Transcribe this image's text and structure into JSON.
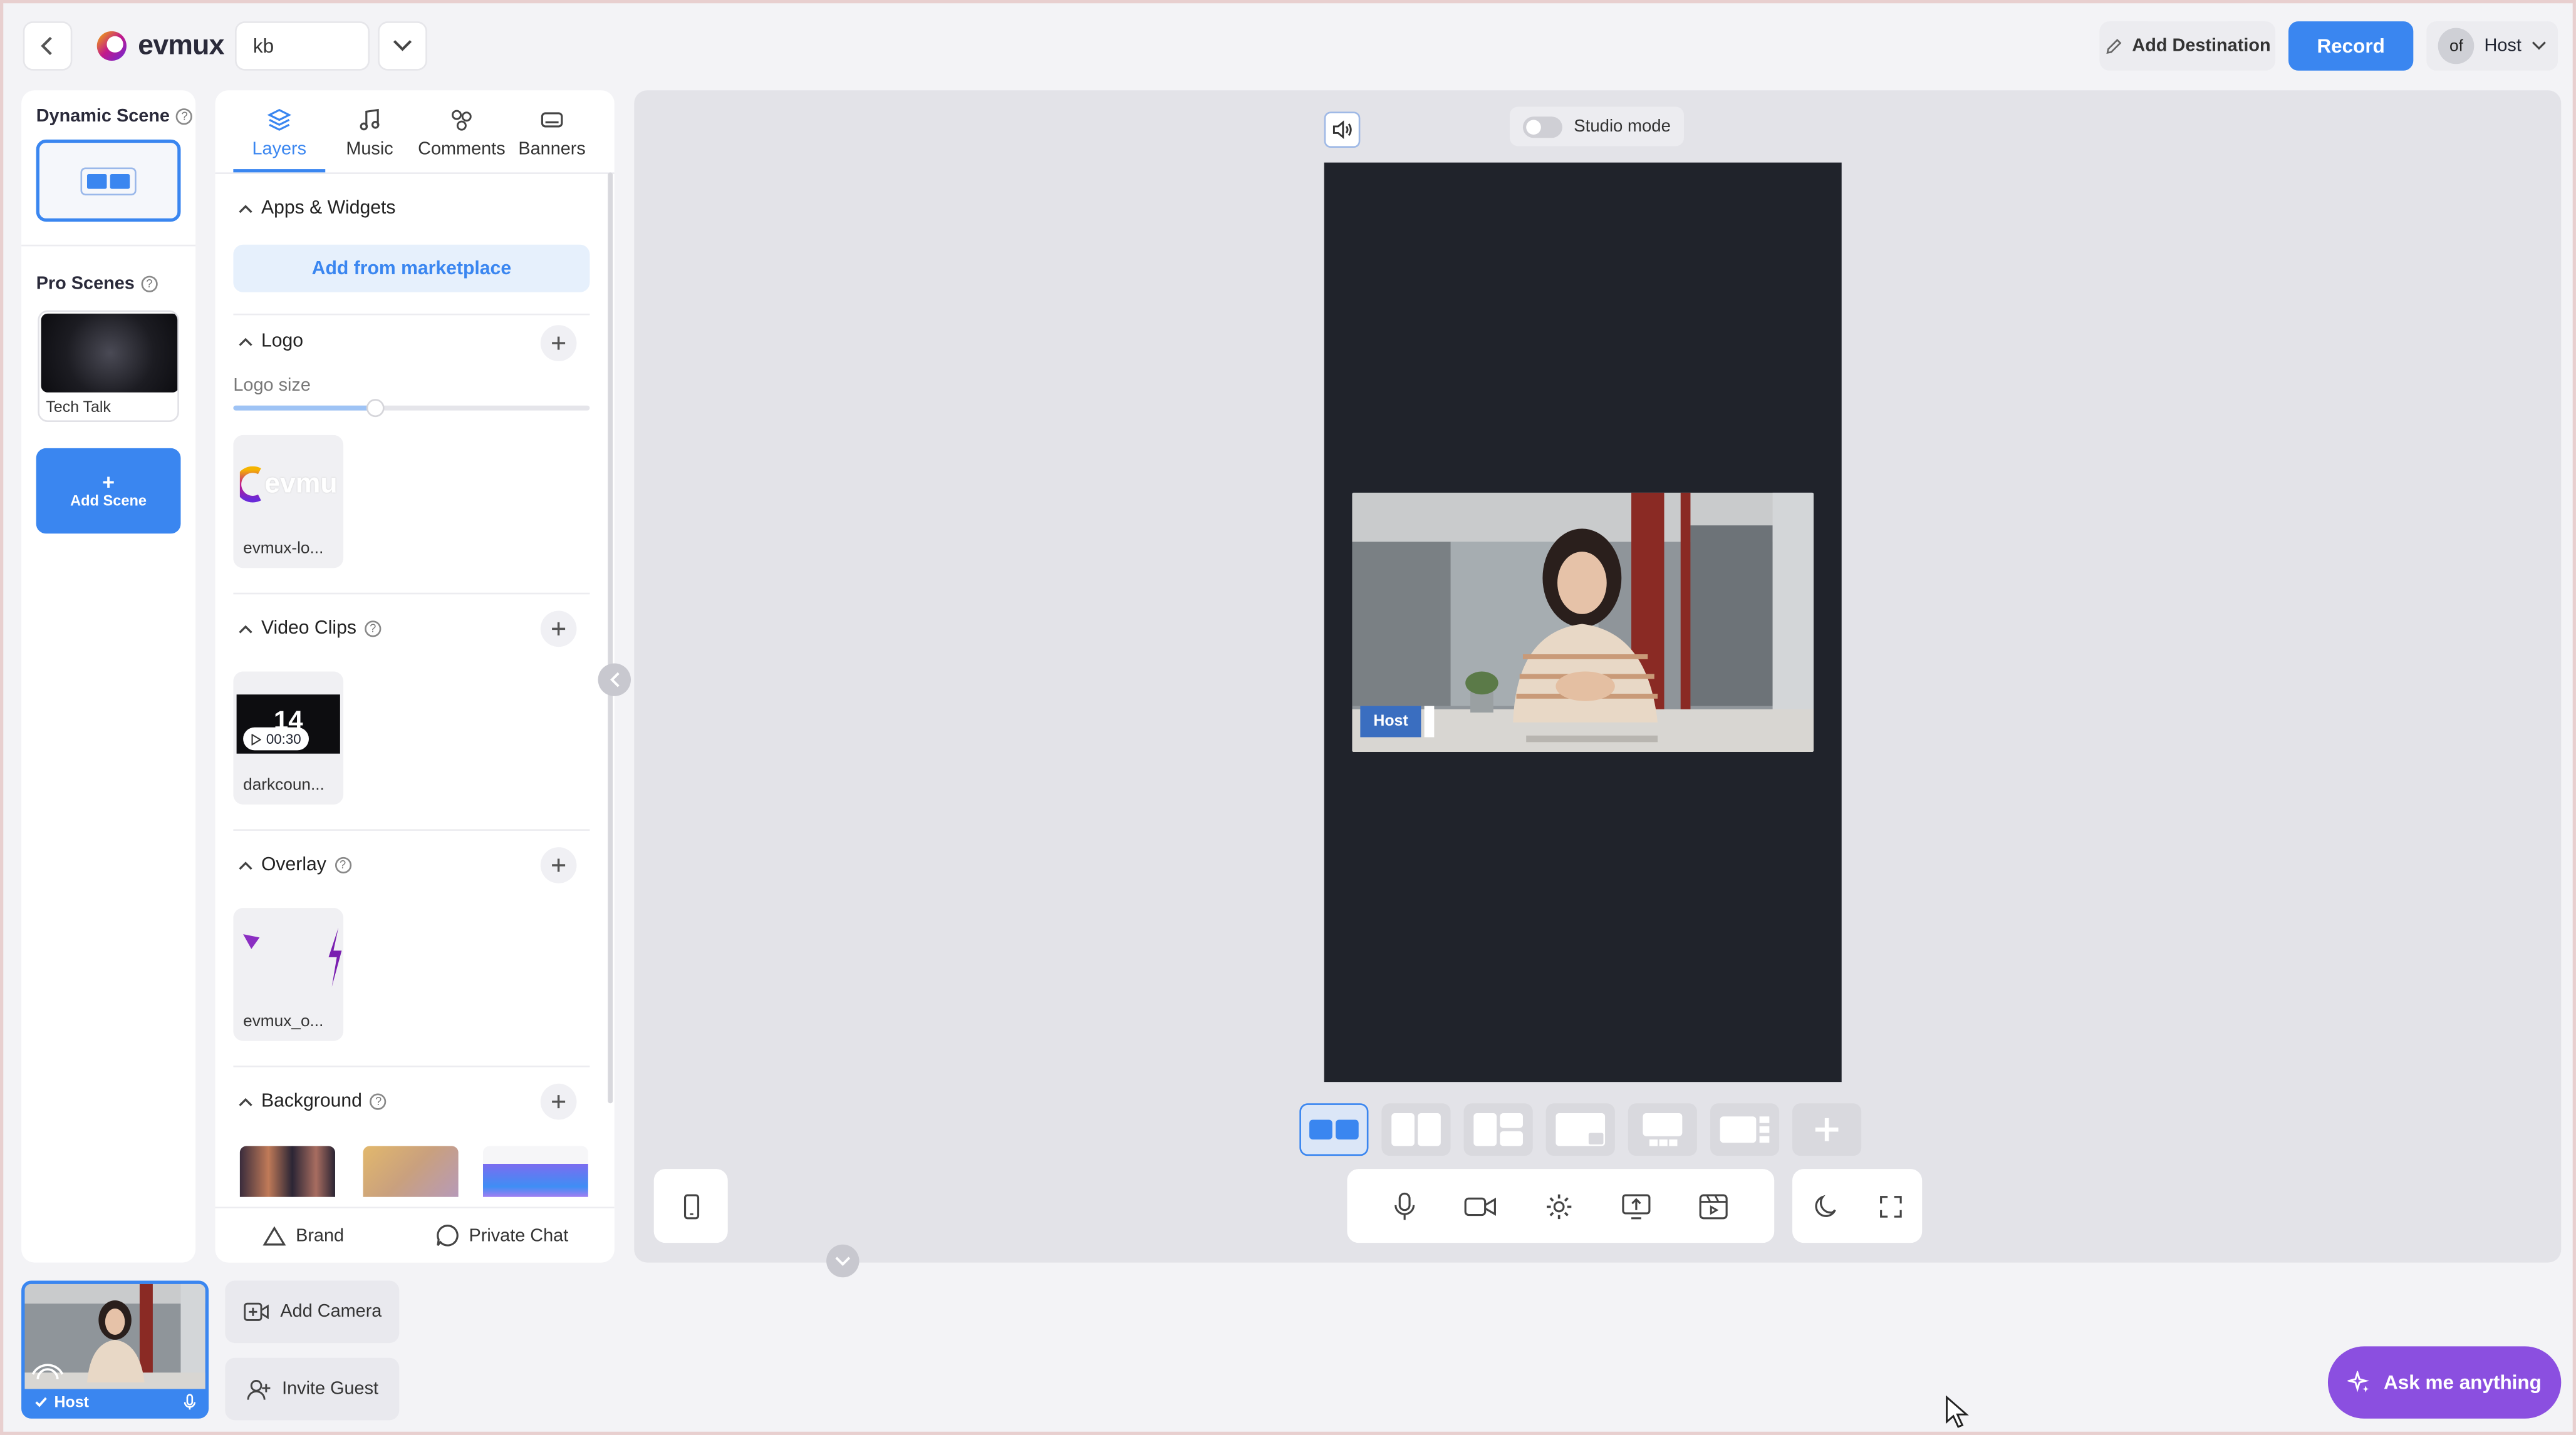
{
  "header": {
    "app_name": "evmux",
    "room_value": "kb",
    "add_destination_label": "Add Destination",
    "record_label": "Record",
    "user_initials": "of",
    "user_role": "Host"
  },
  "scenes": {
    "dynamic_title": "Dynamic Scene",
    "pro_title": "Pro Scenes",
    "pro_items": [
      {
        "label": "Tech Talk"
      }
    ],
    "add_scene_label": "Add Scene",
    "add_scene_plus": "+"
  },
  "panel": {
    "tabs": [
      {
        "label": "Layers",
        "icon": "layers-icon",
        "active": true
      },
      {
        "label": "Music",
        "icon": "music-icon",
        "active": false
      },
      {
        "label": "Comments",
        "icon": "comments-icon",
        "active": false
      },
      {
        "label": "Banners",
        "icon": "banners-icon",
        "active": false
      }
    ],
    "apps_widgets_title": "Apps & Widgets",
    "marketplace_label": "Add from marketplace",
    "logo_title": "Logo",
    "logo_size_label": "Logo size",
    "logo_size_value": 0.4,
    "logo_asset_label": "evmux-lo...",
    "logo_asset_text": "evmu",
    "video_clips_title": "Video Clips",
    "video_clip_label": "darkcoun...",
    "video_clip_duration": "00:30",
    "video_clip_number": "14",
    "overlay_title": "Overlay",
    "overlay_asset_label": "evmux_o...",
    "background_title": "Background",
    "brand_label": "Brand",
    "private_chat_label": "Private Chat"
  },
  "stage": {
    "studio_mode_label": "Studio mode",
    "studio_mode_on": false,
    "name_tag": "Host",
    "layout_count": 7,
    "active_layout": 0
  },
  "bottom": {
    "camera_name": "Host",
    "add_camera_label": "Add Camera",
    "invite_guest_label": "Invite Guest",
    "ask_label": "Ask me anything"
  },
  "colors": {
    "accent": "#3a86f0",
    "ask": "#8b4fe0",
    "canvas": "#20232b"
  }
}
